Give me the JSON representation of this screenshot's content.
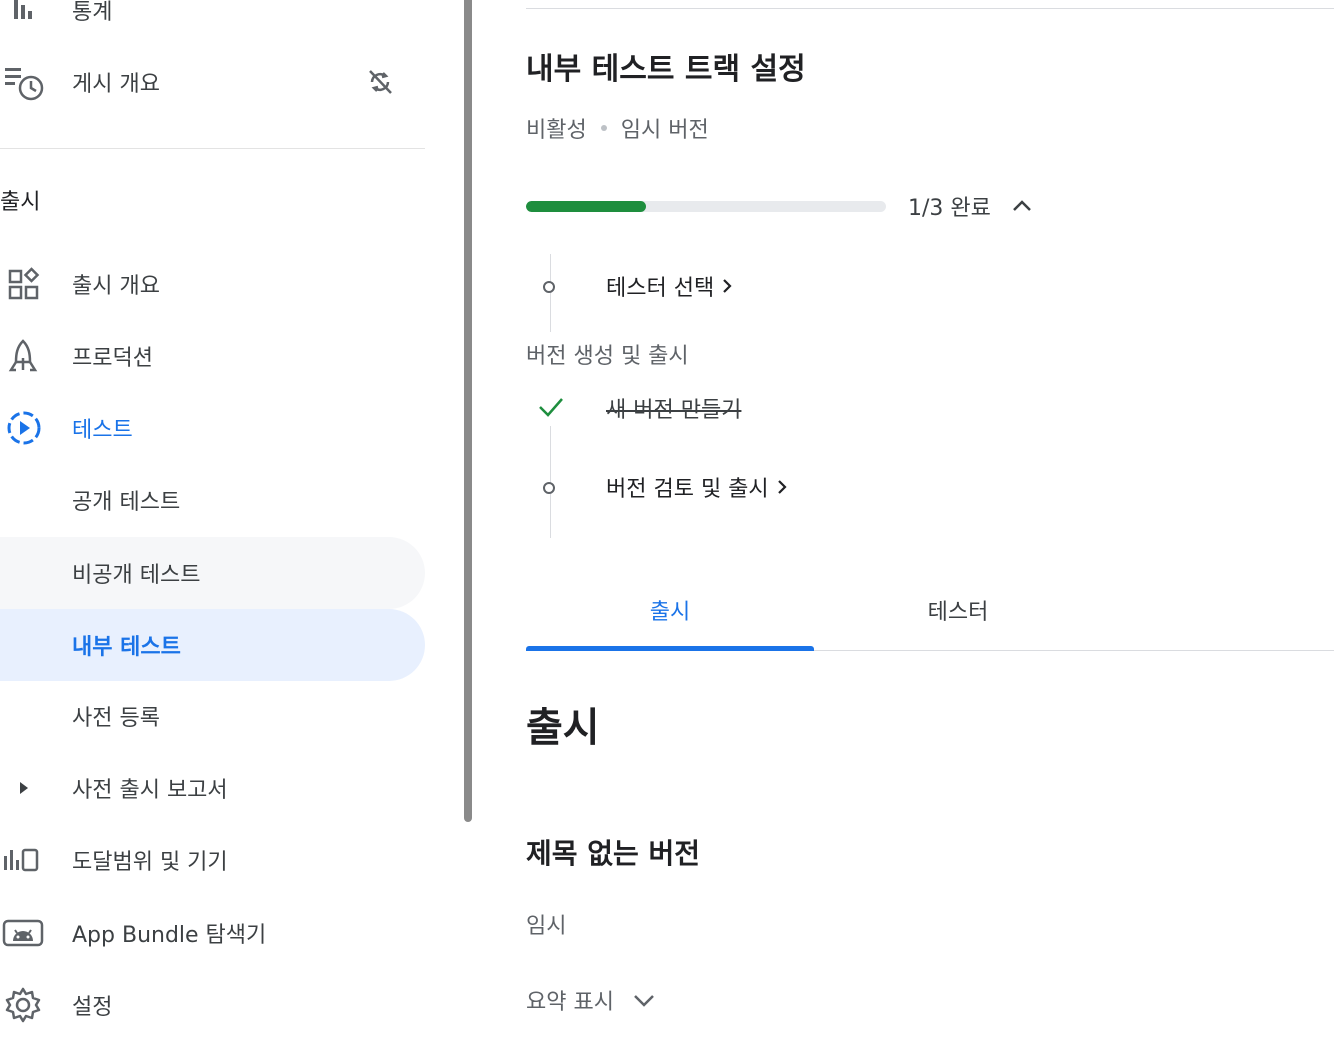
{
  "sidebar": {
    "items_top": [
      {
        "label": "통계",
        "icon": "bar-chart-icon"
      },
      {
        "label": "게시 개요",
        "icon": "publishing-overview-icon",
        "trailing_icon": "sync-disabled-icon"
      }
    ],
    "section_title": "출시",
    "items": [
      {
        "label": "출시 개요",
        "icon": "dashboard-icon"
      },
      {
        "label": "프로덕션",
        "icon": "rocket-icon"
      },
      {
        "label": "테스트",
        "icon": "play-circle-icon"
      },
      {
        "label": "공개 테스트"
      },
      {
        "label": "비공개 테스트"
      },
      {
        "label": "내부 테스트"
      },
      {
        "label": "사전 등록"
      },
      {
        "label": "사전 출시 보고서",
        "icon": "caret-right-icon"
      },
      {
        "label": "도달범위 및 기기",
        "icon": "reach-devices-icon"
      },
      {
        "label": "App Bundle 탐색기",
        "icon": "android-icon"
      },
      {
        "label": "설정",
        "icon": "settings-icon"
      }
    ]
  },
  "main": {
    "title": "내부 테스트 트랙 설정",
    "status": "비활성",
    "status_detail": "임시 버전",
    "progress": {
      "completed": 1,
      "total": 3,
      "fraction": 0.333,
      "label": "1/3 완료"
    },
    "steps": {
      "step1": "테스터 선택",
      "group_label": "버전 생성 및 출시",
      "step2": "새 버전 만들기",
      "step3": "버전 검토 및 출시"
    },
    "tabs": [
      "출시",
      "테스터"
    ],
    "section_heading": "출시",
    "release": {
      "name": "제목 없는 버전",
      "status": "임시",
      "summary_toggle": "요약 표시"
    }
  },
  "colors": {
    "accent": "#1a73e8",
    "progress": "#1e8e3e",
    "selected_bg": "#e8f0fe"
  }
}
